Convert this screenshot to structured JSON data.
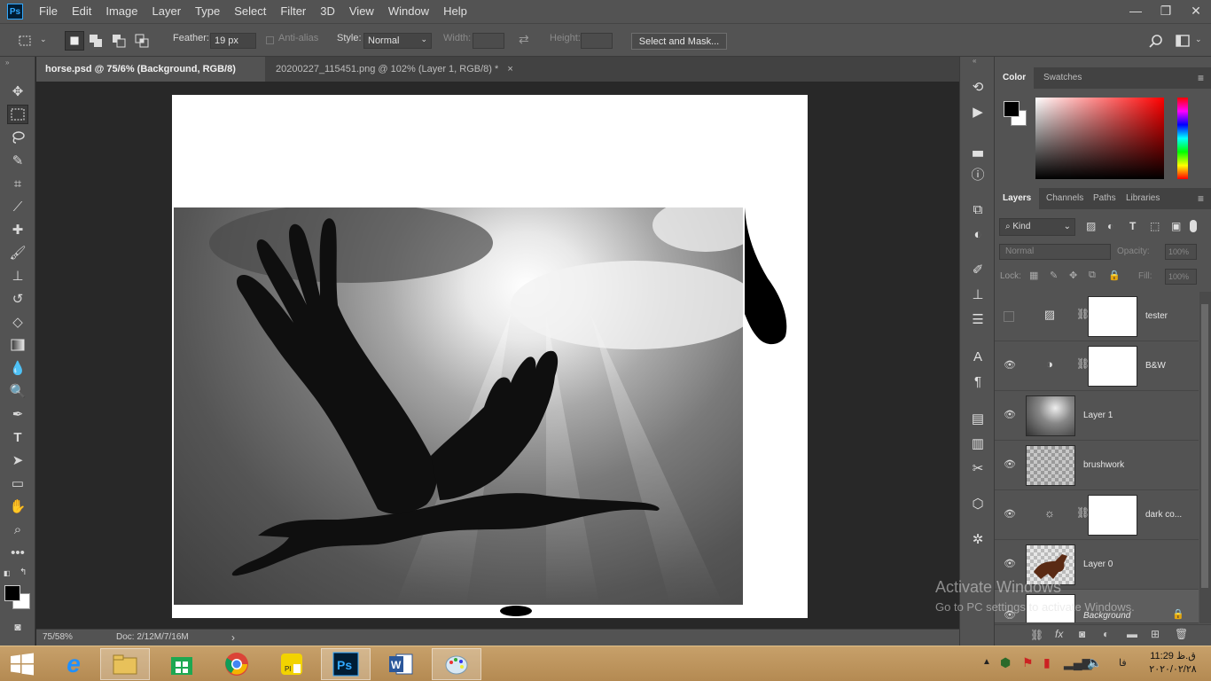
{
  "app": {
    "logo": "Ps"
  },
  "menu": [
    "File",
    "Edit",
    "Image",
    "Layer",
    "Type",
    "Select",
    "Filter",
    "3D",
    "View",
    "Window",
    "Help"
  ],
  "window_controls": {
    "minimize": "—",
    "restore": "❐",
    "close": "✕"
  },
  "options": {
    "feather_label": "Feather:",
    "feather_value": "19 px",
    "antialias_label": "Anti-alias",
    "style_label": "Style:",
    "style_value": "Normal",
    "width_label": "Width:",
    "height_label": "Height:",
    "select_mask_label": "Select and Mask..."
  },
  "tabs": [
    {
      "label": "horse.psd @ 75/6% (Background, RGB/8) *",
      "close": "×"
    },
    {
      "label": "20200227_115451.png @ 102% (Layer 1, RGB/8) *",
      "close": "×"
    }
  ],
  "status": {
    "zoom": "75/58%",
    "doc": "Doc: 2/12M/7/16M",
    "arrow": "›"
  },
  "color_panel": {
    "tabs": [
      "Color",
      "Swatches"
    ],
    "fg_color": "#000000",
    "bg_color": "#ffffff"
  },
  "layers_panel": {
    "tabs": [
      "Layers",
      "Channels",
      "Paths",
      "Libraries"
    ],
    "filter_label": "Kind",
    "blend_mode": "Normal",
    "opacity_label": "Opacity:",
    "opacity_value": "100%",
    "lock_label": "Lock:",
    "fill_label": "Fill:",
    "fill_value": "100%",
    "layers": [
      {
        "name": "tester",
        "visible": false,
        "type": "adjustment",
        "icon": "gradient-map-icon"
      },
      {
        "name": "B&W",
        "visible": true,
        "type": "adjustment",
        "icon": "black-white-icon"
      },
      {
        "name": "Layer 1",
        "visible": true,
        "type": "image",
        "icon": "image-thumb"
      },
      {
        "name": "brushwork",
        "visible": true,
        "type": "image",
        "icon": "transparent-thumb"
      },
      {
        "name": "dark co...",
        "visible": true,
        "type": "adjustment",
        "icon": "brightness-icon"
      },
      {
        "name": "Layer 0",
        "visible": true,
        "type": "image",
        "icon": "horse-thumb"
      },
      {
        "name": "Background",
        "visible": true,
        "type": "background",
        "icon": "lock-icon"
      }
    ]
  },
  "watermark": {
    "title": "Activate Windows",
    "subtitle": "Go to PC settings to activate Windows."
  },
  "taskbar": {
    "apps": [
      "start",
      "internet-explorer",
      "file-explorer",
      "store",
      "chrome",
      "player",
      "photoshop",
      "word",
      "paint"
    ],
    "time": "11:29 ق.ظ",
    "date": "۲۰۲۰/۰۲/۲۸",
    "lang": "فا"
  }
}
